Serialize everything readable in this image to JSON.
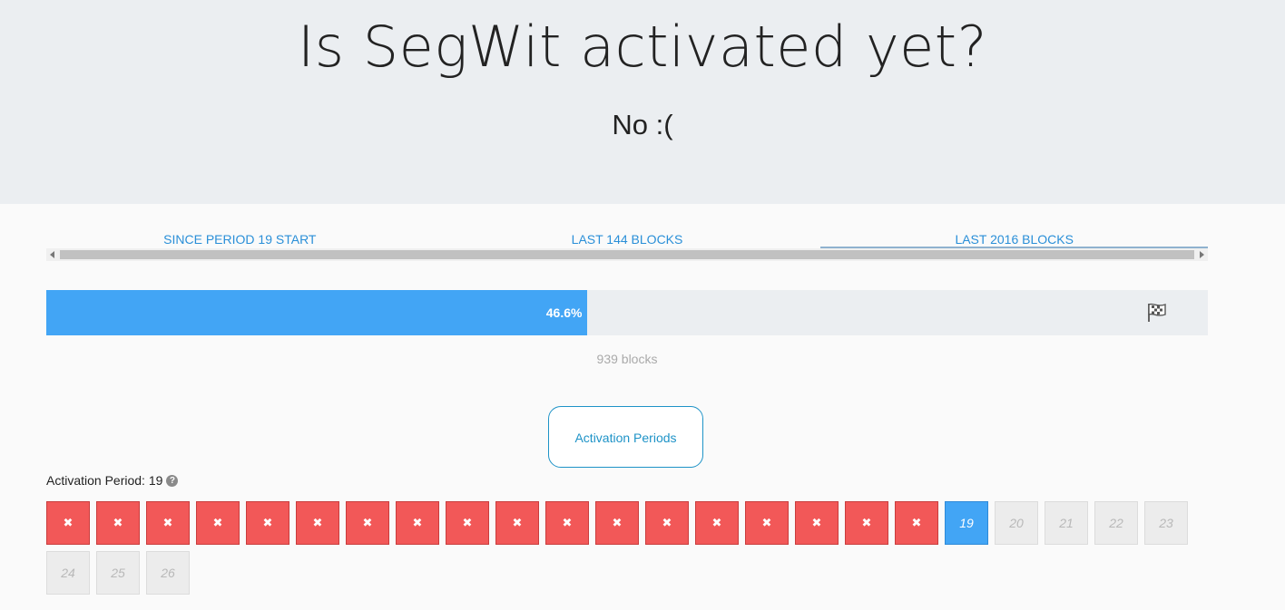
{
  "hero": {
    "title": "Is SegWit activated yet?",
    "answer": "No :("
  },
  "tabs": [
    {
      "label": "SINCE PERIOD 19 START",
      "active": false
    },
    {
      "label": "LAST 144 BLOCKS",
      "active": false
    },
    {
      "label": "LAST 2016 BLOCKS",
      "active": true
    }
  ],
  "progress": {
    "fraction": 0.466,
    "percent_label": "46.6%",
    "blocks_label": "939 blocks",
    "fill_color": "#42a5f5",
    "goal_icon": "checkered-flag-icon"
  },
  "activation_button": {
    "label": "Activation Periods"
  },
  "activation_period": {
    "label": "Activation Period: 19",
    "help_icon": "question-circle-icon"
  },
  "periods": {
    "colors": {
      "failed": "#f25858",
      "current": "#42a5f5",
      "future": "#ececec"
    },
    "failed_count": 18,
    "failed_icon": "x-icon",
    "failed_mark": "✖",
    "current": "19",
    "future": [
      "20",
      "21",
      "22",
      "23",
      "24",
      "25",
      "26"
    ]
  }
}
